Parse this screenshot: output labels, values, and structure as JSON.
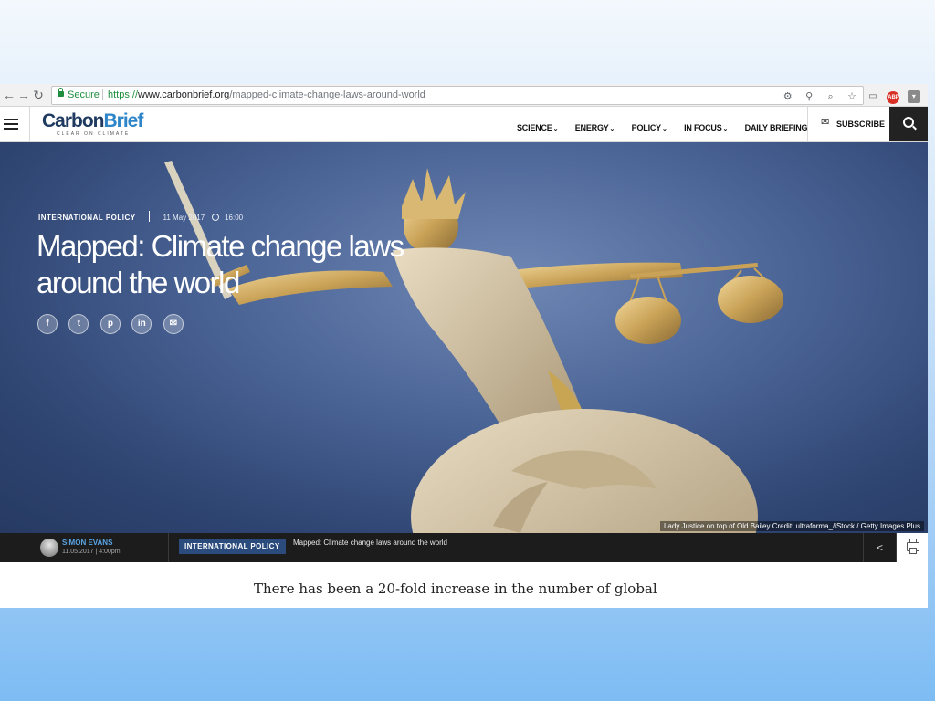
{
  "browser": {
    "secure_label": "Secure",
    "url_scheme": "https://",
    "url_domain": "www.carbonbrief.org",
    "url_path": "/mapped-climate-change-laws-around-world",
    "nav_icons": [
      "back-icon",
      "forward-icon",
      "reload-icon"
    ],
    "url_icons": [
      "lastpass-icon",
      "location-icon",
      "zoom-icon",
      "bookmark-star-icon"
    ],
    "extension_icons": [
      "cast-icon",
      "adblock-icon",
      "extension-icon",
      "menu-icon"
    ]
  },
  "site": {
    "logo_main": "Carbon",
    "logo_accent": "Brief",
    "logo_tagline": "CLEAR ON CLIMATE",
    "nav": [
      {
        "label": "SCIENCE",
        "dropdown": true
      },
      {
        "label": "ENERGY",
        "dropdown": true
      },
      {
        "label": "POLICY",
        "dropdown": true
      },
      {
        "label": "IN FOCUS",
        "dropdown": true
      },
      {
        "label": "DAILY BRIEFING",
        "dropdown": false
      }
    ],
    "subscribe_label": "SUBSCRIBE"
  },
  "hero": {
    "category": "INTERNATIONAL POLICY",
    "date": "11 May 2017",
    "time": "16:00",
    "title": "Mapped: Climate change laws around the world",
    "share_icons": [
      "facebook-icon",
      "twitter-icon",
      "pinterest-icon",
      "linkedin-icon",
      "email-icon"
    ],
    "photo_credit": "Lady Justice on top of Old Bailey Credit: ultraforma_/iStock / Getty Images Plus",
    "background_color": "#3a5282"
  },
  "article_bar": {
    "author": "SIMON EVANS",
    "author_date": "11.05.2017 | 4:00pm",
    "category": "INTERNATIONAL POLICY",
    "title": "Mapped: Climate change laws around the world",
    "accent_color": "#2b4b7c"
  },
  "article": {
    "intro_line": "There has been a 20-fold increase in the number of global"
  }
}
